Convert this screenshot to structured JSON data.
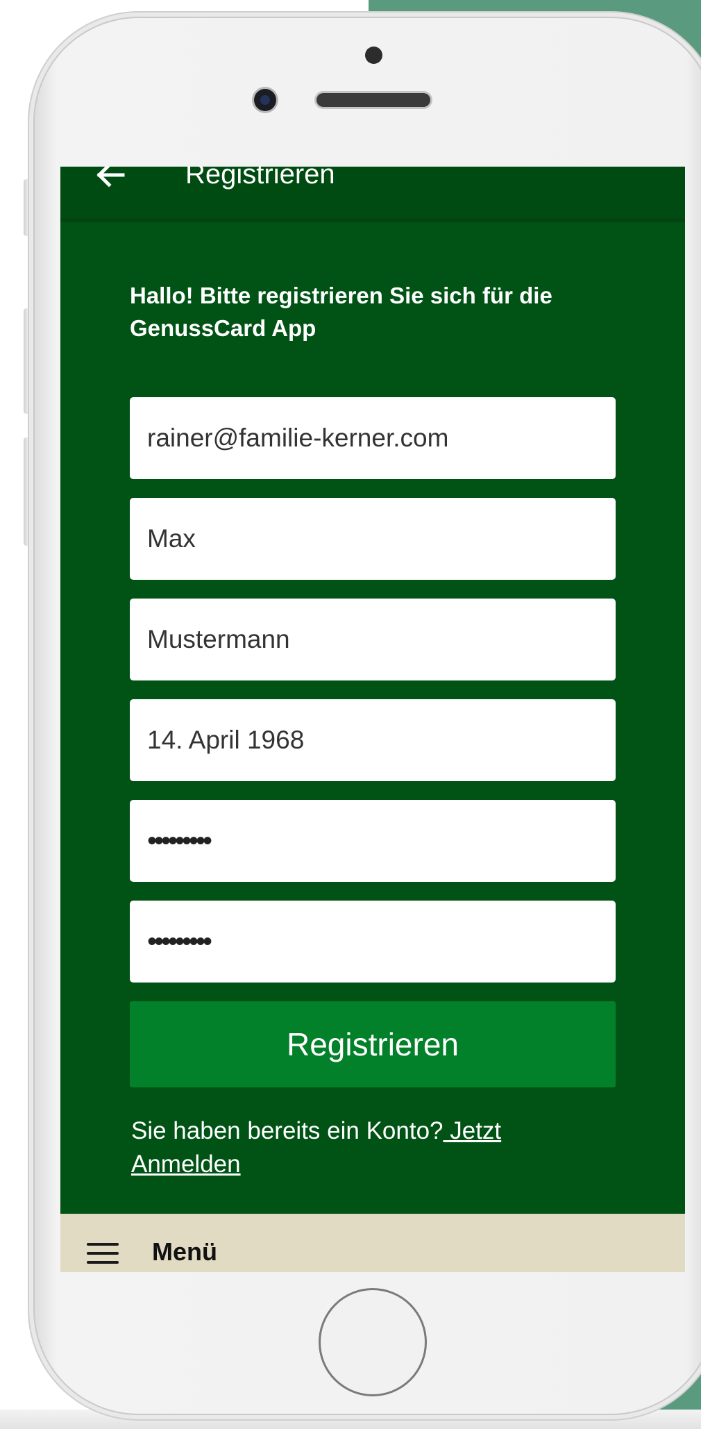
{
  "colors": {
    "screen_bg": "#005215",
    "appbar_bg": "#004b12",
    "button_bg": "#03802a",
    "bottom_bar_bg": "#e1dbc4",
    "backdrop_accent": "#5a9a7e"
  },
  "appbar": {
    "back_icon": "arrow-left-icon",
    "title": "Registrieren"
  },
  "form": {
    "intro": "Hallo! Bitte registrieren Sie sich für die GenussCard App",
    "email_value": "rainer@familie-kerner.com",
    "first_name_value": "Max",
    "last_name_value": "Mustermann",
    "birthdate_value": "14. April 1968",
    "password_value": "•••••••••",
    "password_confirm_value": "•••••••••",
    "submit_label": "Registrieren"
  },
  "login_prompt": {
    "text": "Sie haben bereits ein Konto?",
    "link": " Jetzt Anmelden"
  },
  "bottom_bar": {
    "menu_icon": "hamburger-icon",
    "menu_label": "Menü"
  }
}
